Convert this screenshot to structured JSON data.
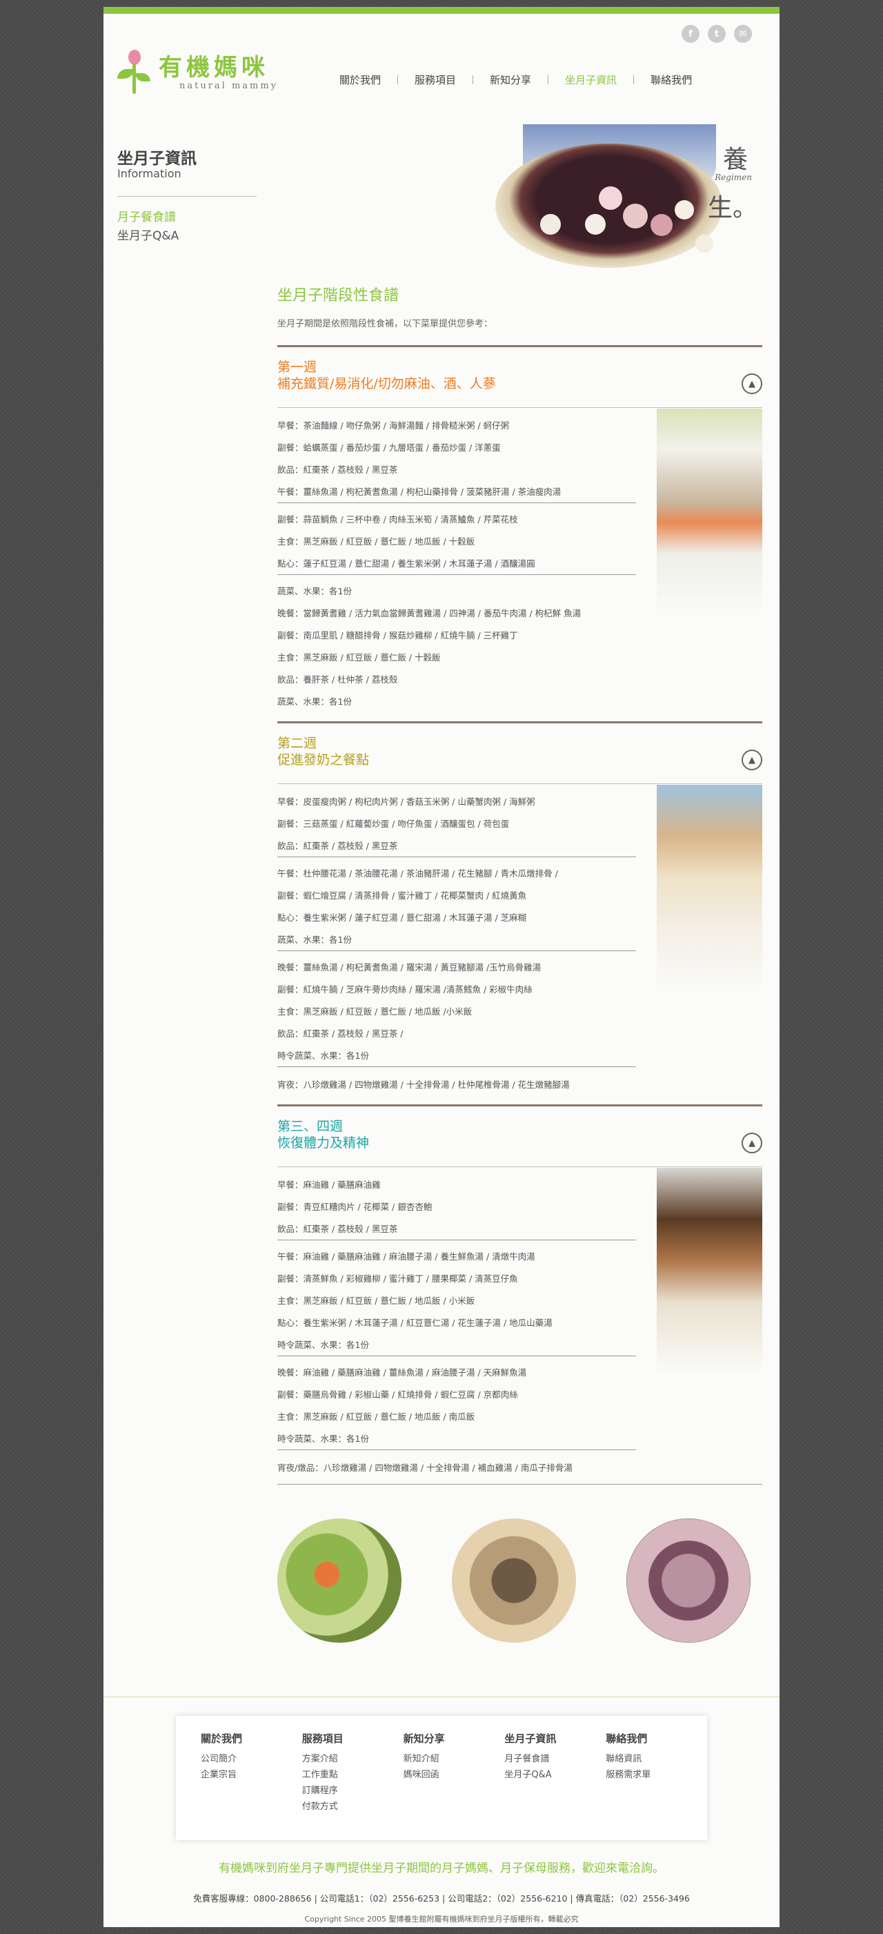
{
  "site": {
    "logo_zh": "有機媽咪",
    "logo_en": "natural mammy",
    "social": [
      "f",
      "t",
      "✉"
    ]
  },
  "nav": [
    "關於我們",
    "服務項目",
    "新知分享",
    "坐月子資訊",
    "聯絡我們"
  ],
  "nav_active": 3,
  "sidebar": {
    "title": "坐月子資訊",
    "subtitle": "Information",
    "links": [
      "月子餐食譜",
      "坐月子Q&A"
    ]
  },
  "hero": {
    "char1": "養",
    "regimen": "Regimen",
    "char2": "生。"
  },
  "content": {
    "title": "坐月子階段性食譜",
    "intro": "坐月子期間是依照階段性食補，以下菜單提供您參考："
  },
  "week1": {
    "week": "第一週",
    "subtitle": "補充鐵質/易消化/切勿麻油、酒、人蔘",
    "rows": [
      "早餐：茶油麵線 / 吻仔魚粥 / 海鮮湯麵 / 排骨糙米粥 / 蚵仔粥",
      "副餐：蛤蠣蒸蛋 / 番茄炒蛋 / 九層塔蛋 / 番茄炒蛋 / 洋蔥蛋",
      "飲品：紅棗茶 / 荔枝殼 / 黑豆茶",
      "午餐：薑絲魚湯 / 枸杞黃耆魚湯 / 枸杞山藥排骨 / 菠菜豬肝湯 / 茶油瘦肉湯",
      "副餐：蒜苗鯛魚 / 三杯中卷 / 肉絲玉米筍 / 清蒸鱸魚 / 芹菜花枝",
      "主食：黑芝麻飯 / 紅豆飯 / 薏仁飯 / 地瓜飯 / 十穀飯",
      "點心：蓮子紅豆湯 / 薏仁甜湯 / 養生紫米粥 / 木耳蓮子湯 / 酒釀湯圓",
      "蔬菜、水果：各1份",
      "晚餐：當歸黃耆雞 / 活力氣血當歸黃耆雞湯 / 四神湯 / 番茄牛肉湯 / 枸杞鮮 魚湯",
      "副餐：南瓜里肌 / 糖醋排骨 / 猴菇炒雞柳 / 紅燒牛腩 / 三杯雞丁",
      "主食：黑芝麻飯 / 紅豆飯 / 薏仁飯 / 十穀飯",
      "飲品：養肝茶 / 杜仲茶 / 荔枝殼",
      "蔬菜、水果：各1份"
    ]
  },
  "week2": {
    "week": "第二週",
    "subtitle": "促進發奶之餐點",
    "rows": [
      "早餐：皮蛋瘦肉粥 / 枸杞肉片粥 / 香菇玉米粥 / 山藥蟹肉粥 / 海鮮粥",
      "副餐：三菇蒸蛋 / 紅蘿蔔炒蛋 / 吻仔魚蛋 / 酒釀蛋包 / 荷包蛋",
      "飲品：紅棗茶 / 荔枝殼 / 黑豆茶",
      "午餐：杜仲腰花湯 / 茶油腰花湯 / 茶油豬肝湯 / 花生豬腳 / 青木瓜燉排骨 /",
      "副餐：蝦仁燴豆腐 / 清蒸排骨 / 蜜汁雞丁 / 花椰菜蟹肉 / 紅燒黃魚",
      "點心：養生紫米粥 / 蓮子紅豆湯 / 薏仁甜湯 / 木耳蓮子湯 / 芝麻糊",
      "蔬菜、水果：各1份",
      "晚餐：薑絲魚湯 / 枸杞黃耆魚湯 / 羅宋湯 / 黃豆豬腳湯 /玉竹烏骨雞湯",
      "副餐：紅燒牛腩 / 芝麻牛蒡炒肉絲 / 羅宋湯 /清蒸鱈魚 / 彩椒牛肉絲",
      "主食：黑芝麻飯 / 紅豆飯 / 薏仁飯 / 地瓜飯 /小米飯",
      "飲品：紅棗茶 / 荔枝殼 / 黑豆茶 /",
      "時令蔬菜、水果：各1份",
      "宵夜：八珍燉雞湯 / 四物燉雞湯 / 十全排骨湯 / 杜仲尾椎骨湯 / 花生燉豬腳湯"
    ]
  },
  "week3": {
    "week": "第三、四週",
    "subtitle": "恢復體力及精神",
    "rows": [
      "早餐：麻油雞 / 藥膳麻油雞",
      "副餐：青豆紅糟肉片 / 花椰菜 / 銀杏杏鮑",
      "飲品：紅棗茶 / 荔枝殼 / 黑豆茶",
      "午餐：麻油雞 / 藥膳麻油雞 / 麻油腰子湯 / 養生鮮魚湯 / 清燉牛肉湯",
      "副餐：清蒸鮮魚 / 彩椒雞柳 / 蜜汁雞丁 / 腰果椰菜 / 清蒸豆仔魚",
      "主食：黑芝麻飯 / 紅豆飯 / 薏仁飯 / 地瓜飯 / 小米飯",
      "點心：養生紫米粥 / 木耳蓮子湯 / 紅豆薏仁湯 / 花生蓮子湯 / 地瓜山藥湯",
      "時令蔬菜、水果：各1份",
      "晚餐：麻油雞 / 藥膳麻油雞 / 薑絲魚湯 / 麻油腰子湯 / 天麻鮮魚湯",
      "副餐：藥膳烏骨雞 / 彩椒山藥 / 紅燒排骨 / 蝦仁豆腐 / 京都肉絲",
      "主食：黑芝麻飯 / 紅豆飯 / 薏仁飯 / 地瓜飯 / 南瓜飯",
      "時令蔬菜、水果：各1份",
      "宵夜/燉品：八珍燉雞湯 / 四物燉雞湯 / 十全排骨湯 / 補血雞湯 / 南瓜子排骨湯"
    ]
  },
  "footer": {
    "columns": [
      {
        "title": "關於我們",
        "links": [
          "公司簡介",
          "企業宗旨"
        ]
      },
      {
        "title": "服務項目",
        "links": [
          "方案介紹",
          "工作重點",
          "訂購程序",
          "付款方式"
        ]
      },
      {
        "title": "新知分享",
        "links": [
          "新知介紹",
          "媽咪回函"
        ]
      },
      {
        "title": "坐月子資訊",
        "links": [
          "月子餐食譜",
          "坐月子Q&A"
        ]
      },
      {
        "title": "聯絡我們",
        "links": [
          "聯絡資訊",
          "服務需求單"
        ]
      }
    ],
    "slogan": "有機媽咪到府坐月子專門提供坐月子期間的月子媽媽、月子保母服務，歡迎來電洽詢。",
    "contact": "免費客服專線：0800-288656 | 公司電話1：（02）2556-6253 | 公司電話2：（02）2556-6210 | 傳真電話：（02）2556-3496",
    "copyright": "Copyright Since 2005 聖博養生館附屬有機媽咪到府坐月子版權所有，轉載必究"
  },
  "colors": {
    "accent": "#8cc63f",
    "week1": "#f07b1f",
    "week2": "#b5a11d",
    "week3": "#1aa6a6"
  }
}
